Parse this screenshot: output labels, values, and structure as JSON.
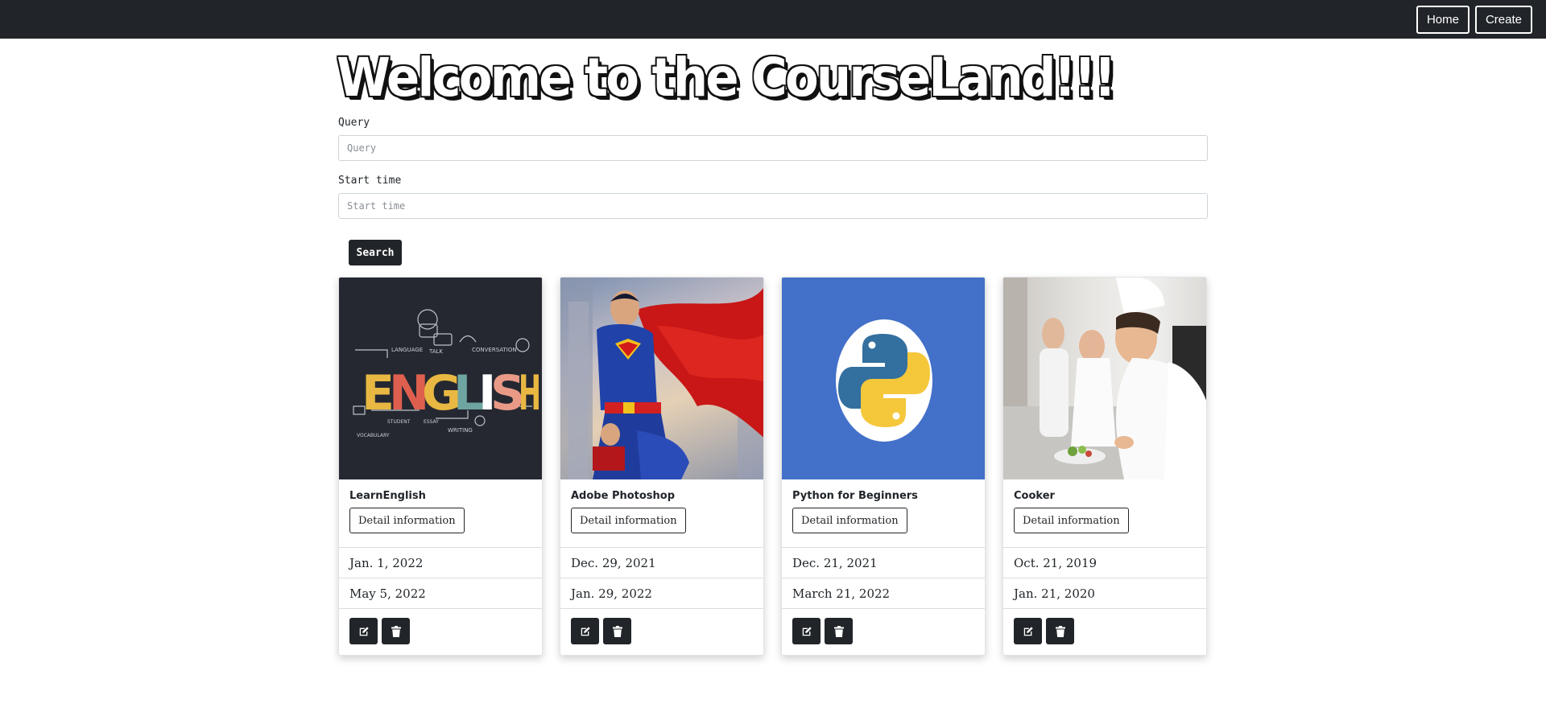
{
  "nav": {
    "home_label": "Home",
    "create_label": "Create"
  },
  "page": {
    "title": "Welcome to the CourseLand!!!"
  },
  "form": {
    "query_label": "Query",
    "query_placeholder": "Query",
    "query_value": "",
    "start_label": "Start time",
    "start_placeholder": "Start time",
    "start_value": "",
    "search_label": "Search"
  },
  "cards": [
    {
      "title": "LearnEnglish",
      "detail_label": "Detail information",
      "start_date": "Jan. 1, 2022",
      "end_date": "May 5, 2022",
      "image": "english-banner"
    },
    {
      "title": "Adobe Photoshop",
      "detail_label": "Detail information",
      "start_date": "Dec. 29, 2021",
      "end_date": "Jan. 29, 2022",
      "image": "superhero-art"
    },
    {
      "title": "Python for Beginners",
      "detail_label": "Detail information",
      "start_date": "Dec. 21, 2021",
      "end_date": "March 21, 2022",
      "image": "python-logo"
    },
    {
      "title": "Cooker",
      "detail_label": "Detail information",
      "start_date": "Oct. 21, 2019",
      "end_date": "Jan. 21, 2020",
      "image": "chefs-photo"
    }
  ],
  "icons": {
    "edit": "edit-icon",
    "delete": "trash-icon"
  },
  "colors": {
    "navbar": "#212529",
    "button_dark": "#212529",
    "python_bg": "#4370c8"
  }
}
